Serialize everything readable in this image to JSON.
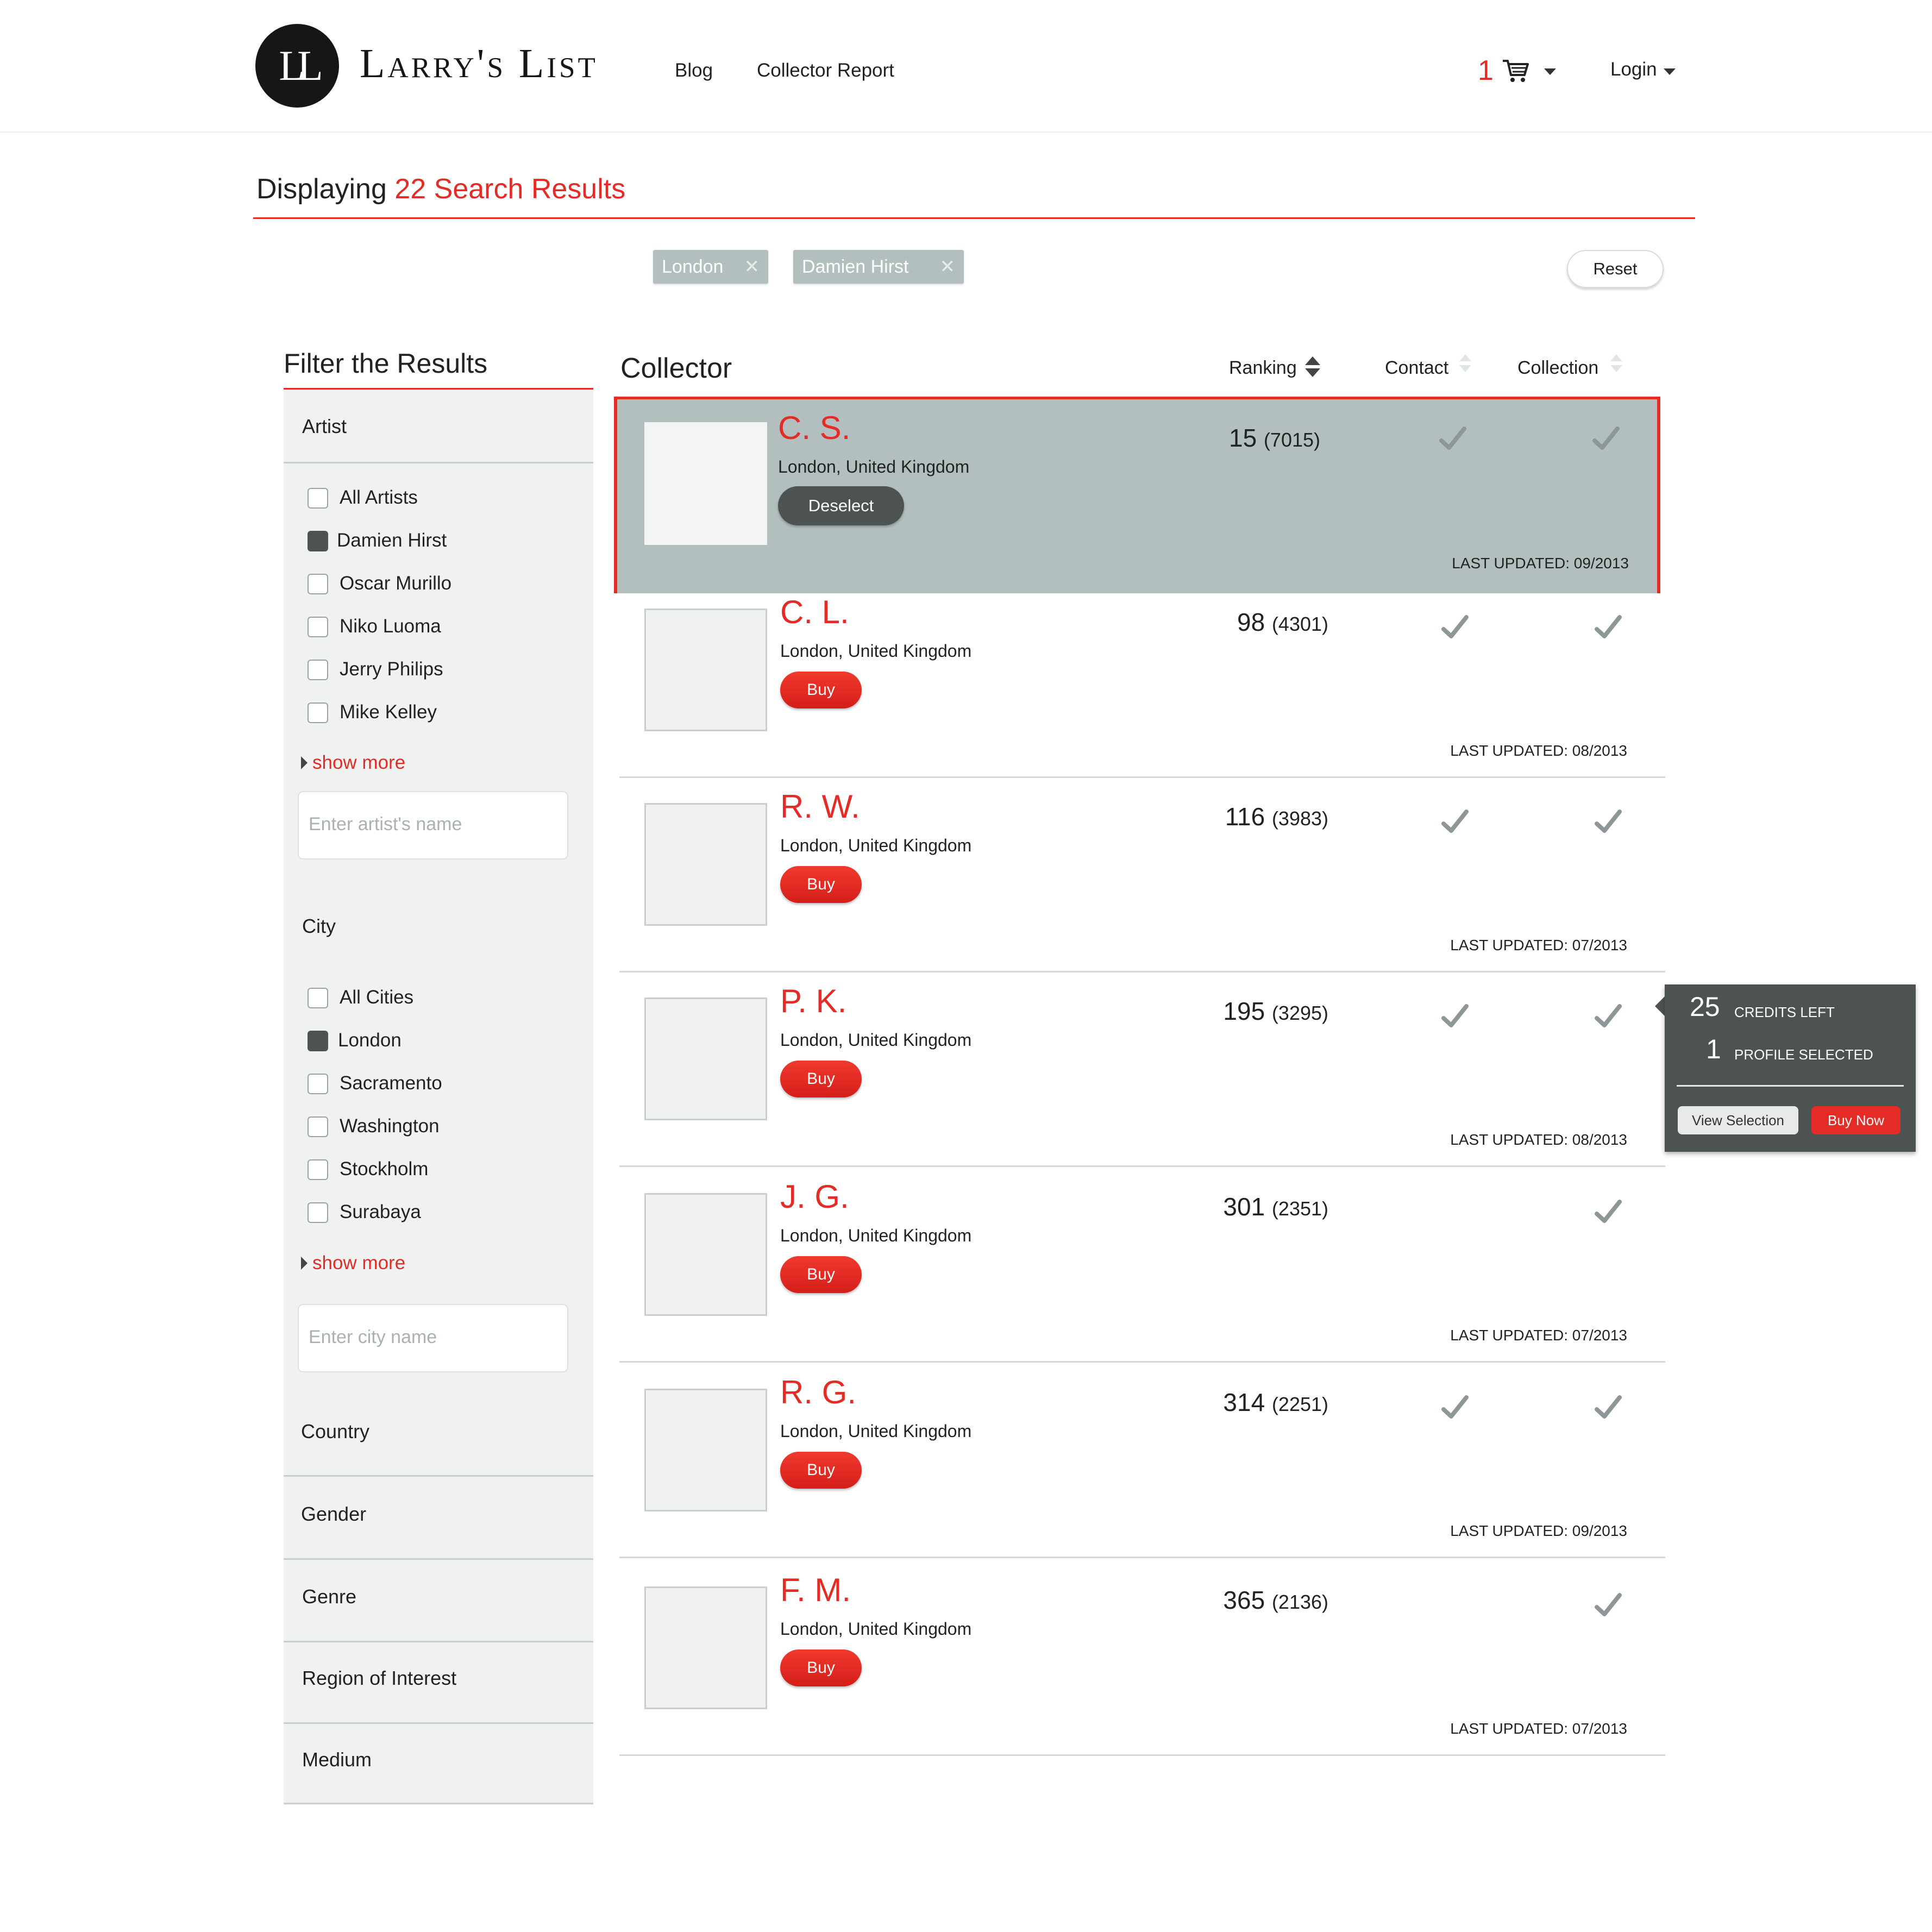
{
  "header": {
    "logo_monogram": "LL",
    "logo_text": "Larry's List",
    "nav": [
      "Blog",
      "Collector Report"
    ],
    "cart_count": "1",
    "login_label": "Login"
  },
  "results": {
    "prefix": "Displaying",
    "count_text": "22 Search Results"
  },
  "active_filters": [
    "London",
    "Damien Hirst"
  ],
  "reset_label": "Reset",
  "filters": {
    "heading": "Filter the Results",
    "artist": {
      "label": "Artist",
      "options": [
        {
          "label": "All Artists",
          "checked": false
        },
        {
          "label": "Damien Hirst",
          "checked": true
        },
        {
          "label": "Oscar Murillo",
          "checked": false
        },
        {
          "label": "Niko Luoma",
          "checked": false
        },
        {
          "label": "Jerry Philips",
          "checked": false
        },
        {
          "label": "Mike Kelley",
          "checked": false
        }
      ],
      "show_more": "show more",
      "placeholder": "Enter artist's name"
    },
    "city": {
      "label": "City",
      "options": [
        {
          "label": "All Cities",
          "checked": false
        },
        {
          "label": "London",
          "checked": true
        },
        {
          "label": "Sacramento",
          "checked": false
        },
        {
          "label": "Washington",
          "checked": false
        },
        {
          "label": "Stockholm",
          "checked": false
        },
        {
          "label": "Surabaya",
          "checked": false
        }
      ],
      "show_more": "show more",
      "placeholder": "Enter city name"
    },
    "collapsed": [
      "Country",
      "Gender",
      "Genre",
      "Region of Interest",
      "Medium"
    ]
  },
  "table": {
    "columns": {
      "collector": "Collector",
      "ranking": "Ranking",
      "contact": "Contact",
      "collection": "Collection"
    },
    "rows": [
      {
        "name": "C. S.",
        "location": "London, United Kingdom",
        "rank": "15",
        "score": "(7015)",
        "contact": true,
        "collection": true,
        "updated": "LAST UPDATED: 09/2013",
        "selected": true,
        "action": "Deselect"
      },
      {
        "name": "C. L.",
        "location": "London, United Kingdom",
        "rank": "98",
        "score": "(4301)",
        "contact": true,
        "collection": true,
        "updated": "LAST UPDATED: 08/2013",
        "selected": false,
        "action": "Buy"
      },
      {
        "name": "R. W.",
        "location": "London, United Kingdom",
        "rank": "116",
        "score": "(3983)",
        "contact": true,
        "collection": true,
        "updated": "LAST UPDATED: 07/2013",
        "selected": false,
        "action": "Buy"
      },
      {
        "name": "P. K.",
        "location": "London, United Kingdom",
        "rank": "195",
        "score": "(3295)",
        "contact": true,
        "collection": true,
        "updated": "LAST UPDATED: 08/2013",
        "selected": false,
        "action": "Buy"
      },
      {
        "name": "J. G.",
        "location": "London, United Kingdom",
        "rank": "301",
        "score": "(2351)",
        "contact": false,
        "collection": true,
        "updated": "LAST UPDATED: 07/2013",
        "selected": false,
        "action": "Buy"
      },
      {
        "name": "R. G.",
        "location": "London, United Kingdom",
        "rank": "314",
        "score": "(2251)",
        "contact": true,
        "collection": true,
        "updated": "LAST UPDATED: 09/2013",
        "selected": false,
        "action": "Buy"
      },
      {
        "name": "F. M.",
        "location": "London, United Kingdom",
        "rank": "365",
        "score": "(2136)",
        "contact": false,
        "collection": true,
        "updated": "LAST UPDATED: 07/2013",
        "selected": false,
        "action": "Buy"
      }
    ]
  },
  "credits": {
    "credits_num": "25",
    "credits_label": "CREDITS LEFT",
    "profiles_num": "1",
    "profiles_label": "PROFILE SELECTED",
    "view_selection": "View Selection",
    "buy_now": "Buy Now"
  },
  "icons": {
    "cart": "shopping-cart-icon",
    "check": "checkmark-icon",
    "remove": "close-icon",
    "sort": "sort-icon",
    "caret": "caret-down-icon"
  },
  "colors": {
    "accent": "#e52b25",
    "selected_row": "#b3bfbe",
    "dark": "#4d5252",
    "sidebar_bg": "#f0f2f1",
    "check": "#8e9797"
  }
}
